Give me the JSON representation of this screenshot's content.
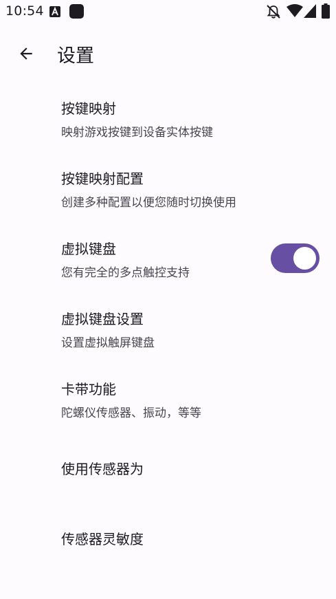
{
  "status": {
    "time": "10:54"
  },
  "appbar": {
    "title": "设置"
  },
  "items": [
    {
      "title": "按键映射",
      "subtitle": "映射游戏按键到设备实体按键"
    },
    {
      "title": "按键映射配置",
      "subtitle": "创建多种配置以便您随时切换使用"
    },
    {
      "title": "虚拟键盘",
      "subtitle": "您有完全的多点触控支持",
      "switch_on": true
    },
    {
      "title": "虚拟键盘设置",
      "subtitle": "设置虚拟触屏键盘"
    },
    {
      "title": "卡带功能",
      "subtitle": "陀螺仪传感器、振动，等等"
    },
    {
      "title": "使用传感器为"
    },
    {
      "title": "传感器灵敏度"
    }
  ],
  "colors": {
    "accent": "#6750a4",
    "background": "#fefbff"
  },
  "icons": [
    "back-arrow-icon",
    "app-a-icon",
    "app-square-icon",
    "notifications-off-icon",
    "wifi-icon",
    "cell-signal-icon",
    "battery-icon"
  ]
}
